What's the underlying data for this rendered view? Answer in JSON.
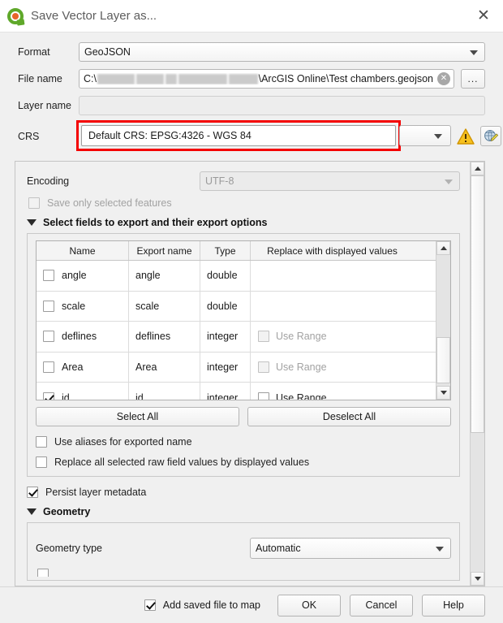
{
  "window": {
    "title": "Save Vector Layer as...",
    "logo_icon": "qgis-logo-icon",
    "close_icon": "close-icon"
  },
  "form": {
    "format_label": "Format",
    "format_value": "GeoJSON",
    "file_name_label": "File name",
    "file_name_prefix": "C:\\",
    "file_name_suffix": "\\ArcGIS Online\\Test chambers.geojson",
    "file_name_clear_icon": "clear-icon",
    "browse_label": "...",
    "layer_name_label": "Layer name",
    "layer_name_value": "",
    "crs_label": "CRS",
    "crs_value": "Default CRS: EPSG:4326 - WGS 84",
    "crs_warning_icon": "warning-icon",
    "crs_select_icon": "globe-select-crs-icon",
    "highlight_color": "#f40000"
  },
  "options": {
    "encoding_label": "Encoding",
    "encoding_value": "UTF-8",
    "save_selected_label": "Save only selected features",
    "save_selected_checked": false,
    "fields_section_title": "Select fields to export and their export options",
    "table": {
      "headers": [
        "Name",
        "Export name",
        "Type",
        "Replace with displayed values"
      ],
      "rows": [
        {
          "checked": false,
          "name": "angle",
          "export_name": "angle",
          "type": "double",
          "use_range_label": "",
          "use_range_enabled": false,
          "use_range_checked": false
        },
        {
          "checked": false,
          "name": "scale",
          "export_name": "scale",
          "type": "double",
          "use_range_label": "",
          "use_range_enabled": false,
          "use_range_checked": false
        },
        {
          "checked": false,
          "name": "deflines",
          "export_name": "deflines",
          "type": "integer",
          "use_range_label": "Use Range",
          "use_range_enabled": false,
          "use_range_checked": false
        },
        {
          "checked": false,
          "name": "Area",
          "export_name": "Area",
          "type": "integer",
          "use_range_label": "Use Range",
          "use_range_enabled": false,
          "use_range_checked": false
        },
        {
          "checked": true,
          "name": "id",
          "export_name": "id",
          "type": "integer",
          "use_range_label": "Use Range",
          "use_range_enabled": true,
          "use_range_checked": false
        }
      ]
    },
    "select_all_label": "Select All",
    "deselect_all_label": "Deselect All",
    "use_aliases_label": "Use aliases for exported name",
    "use_aliases_checked": false,
    "replace_raw_label": "Replace all selected raw field values by displayed values",
    "replace_raw_checked": false,
    "persist_metadata_label": "Persist layer metadata",
    "persist_metadata_checked": true,
    "geometry_section_title": "Geometry",
    "geometry_type_label": "Geometry type",
    "geometry_type_value": "Automatic"
  },
  "footer": {
    "add_to_map_label": "Add saved file to map",
    "add_to_map_checked": true,
    "ok_label": "OK",
    "cancel_label": "Cancel",
    "help_label": "Help"
  }
}
